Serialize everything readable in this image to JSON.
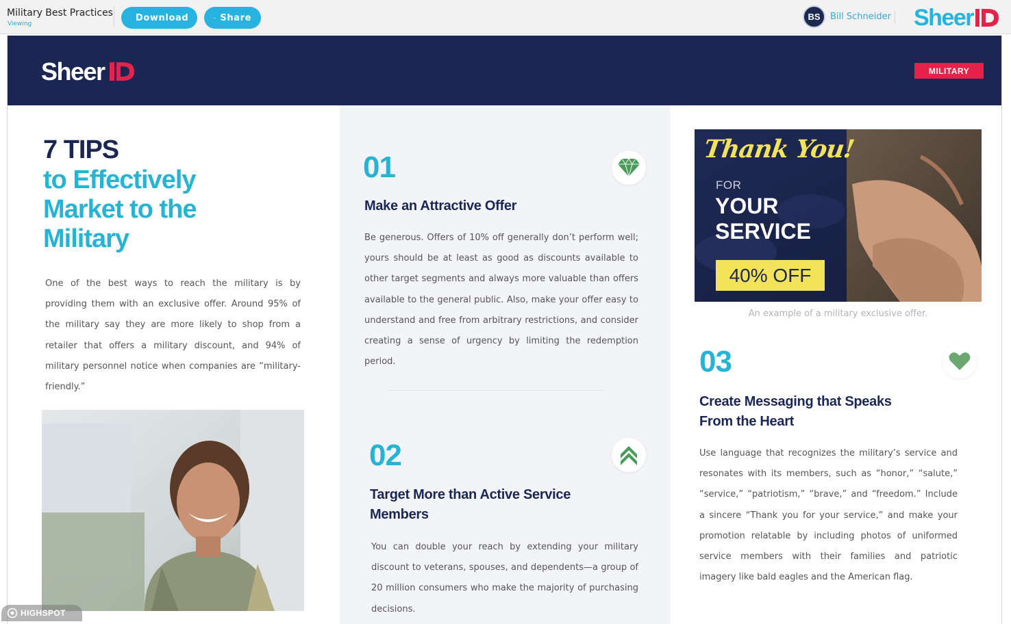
{
  "viewer": {
    "doc_title": "Military Best Practices",
    "doc_status": "Viewing",
    "download_label": "Download",
    "share_label": "Share",
    "user_initials": "BS",
    "user_name": "Bill Schneider",
    "brand_logo": "SheerID",
    "accent_color": "#27b3df"
  },
  "document": {
    "banner_logo": "SheerID",
    "category_tag": "MILITARY",
    "heading_tips": "7 TIPS",
    "heading_sub": "to Effectively Market to the Military",
    "intro": "One of the best ways to reach the military is by providing them with an exclusive offer. Around 95% of the military say they are more likely to shop from a retailer that offers a military discount, and 94% of military personnel notice when companies are “military-friendly.”",
    "tips": [
      {
        "number": "01",
        "title": "Make an Attractive Offer",
        "icon": "diamond-icon",
        "body": "Be generous. Offers of 10% off generally don’t perform well; yours should be at least as good as discounts available to other target segments and always more valuable than offers available to the general public. Also, make your offer easy to understand and free from arbitrary restrictions, and consider creating a sense of urgency by limiting the redemption period."
      },
      {
        "number": "02",
        "title": "Target More than Active Service Members",
        "icon": "chevrons-up-icon",
        "body": "You can double your reach by extending your military discount to veterans, spouses, and dependents—a group of 20 million consumers who make the majority of purchasing decisions."
      },
      {
        "number": "03",
        "title": "Create Messaging that Speaks From the Heart",
        "icon": "heart-icon",
        "body": "Use language that recognizes the military’s service and resonates with its members, such as “honor,” “salute,” “service,” “patriotism,” “brave,” and “freedom.” Include a sincere “Thank you for your service,” and make your promotion relatable by including photos of uniformed service members with their families and patriotic imagery like bald eagles and the American flag."
      }
    ],
    "offer_image": {
      "thank_you": "Thank You!",
      "for": "FOR",
      "your": "YOUR",
      "service": "SERVICE",
      "discount": "40% OFF"
    },
    "offer_caption": "An example of a military exclusive offer.",
    "brand_navy": "#1b2652",
    "brand_teal": "#27b3d3",
    "brand_red": "#e5224a"
  },
  "watermark": "HIGHSPOT"
}
